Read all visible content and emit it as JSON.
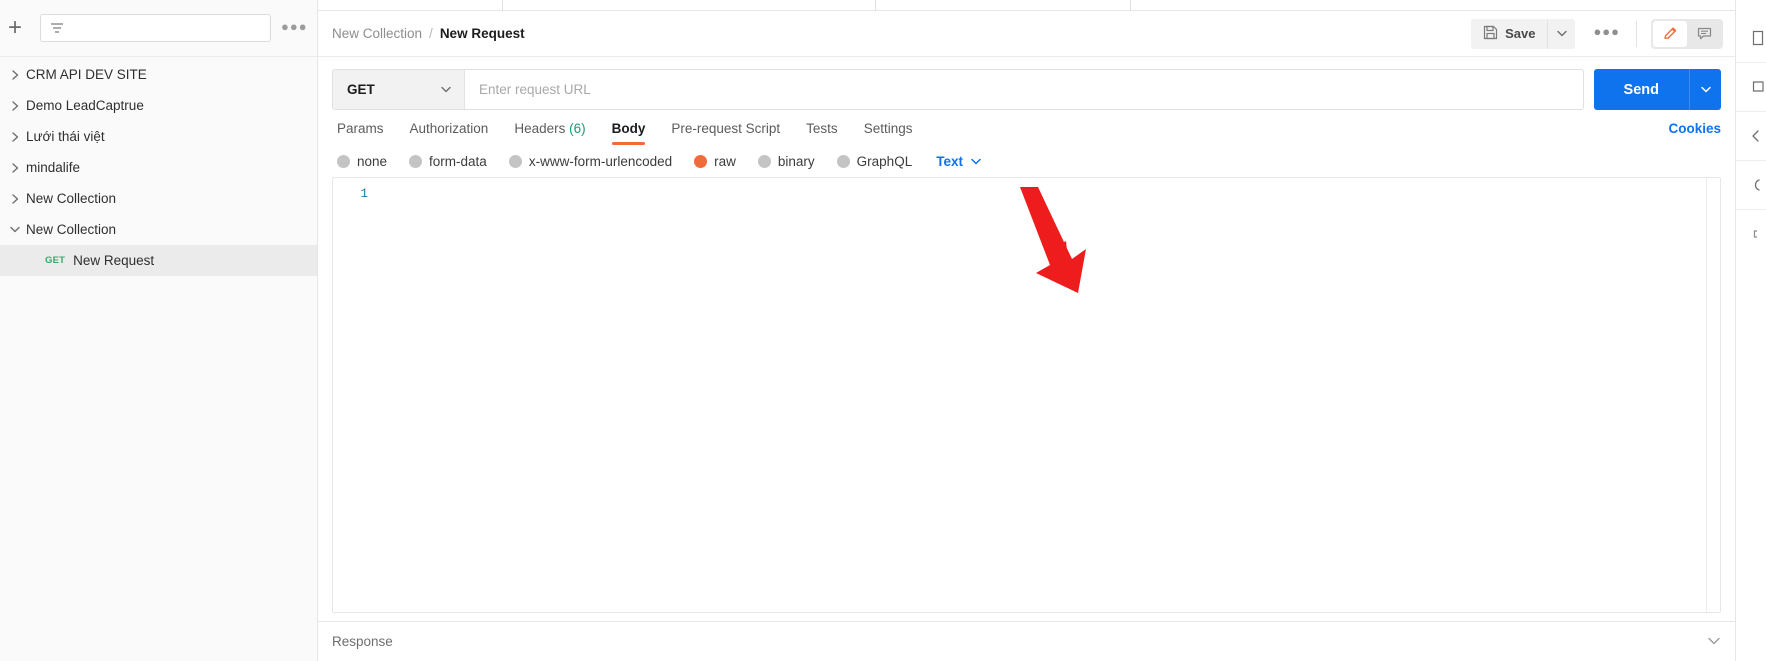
{
  "sidebar": {
    "add_label": "+",
    "filter_placeholder": "",
    "more_label": "●●●",
    "collections": [
      {
        "label": "CRM API DEV SITE",
        "expanded": false
      },
      {
        "label": "Demo LeadCaptrue",
        "expanded": false
      },
      {
        "label": "Lưới thái việt",
        "expanded": false
      },
      {
        "label": "mindalife",
        "expanded": false
      },
      {
        "label": "New Collection",
        "expanded": false
      },
      {
        "label": "New Collection",
        "expanded": true
      }
    ],
    "request": {
      "method": "GET",
      "name": "New Request"
    }
  },
  "header": {
    "breadcrumb_collection": "New Collection",
    "breadcrumb_separator": "/",
    "breadcrumb_request": "New Request",
    "save_label": "Save",
    "more_label": "●●●"
  },
  "request": {
    "method": "GET",
    "url_value": "",
    "url_placeholder": "Enter request URL",
    "send_label": "Send"
  },
  "tabs": [
    {
      "label": "Params",
      "active": false,
      "count": ""
    },
    {
      "label": "Authorization",
      "active": false,
      "count": ""
    },
    {
      "label": "Headers",
      "active": false,
      "count": "(6)"
    },
    {
      "label": "Body",
      "active": true,
      "count": ""
    },
    {
      "label": "Pre-request Script",
      "active": false,
      "count": ""
    },
    {
      "label": "Tests",
      "active": false,
      "count": ""
    },
    {
      "label": "Settings",
      "active": false,
      "count": ""
    }
  ],
  "cookies_label": "Cookies",
  "body_types": [
    {
      "label": "none",
      "selected": false
    },
    {
      "label": "form-data",
      "selected": false
    },
    {
      "label": "x-www-form-urlencoded",
      "selected": false
    },
    {
      "label": "raw",
      "selected": true
    },
    {
      "label": "binary",
      "selected": false
    },
    {
      "label": "GraphQL",
      "selected": false
    }
  ],
  "body_format": "Text",
  "editor": {
    "line_numbers": [
      "1"
    ],
    "content": ""
  },
  "response": {
    "label": "Response"
  },
  "colors": {
    "accent_orange": "#f26b3a",
    "accent_blue": "#0f73ee",
    "method_green": "#3aa76d",
    "count_teal": "#1a9a74",
    "annotation_red": "#ee1c1c"
  }
}
